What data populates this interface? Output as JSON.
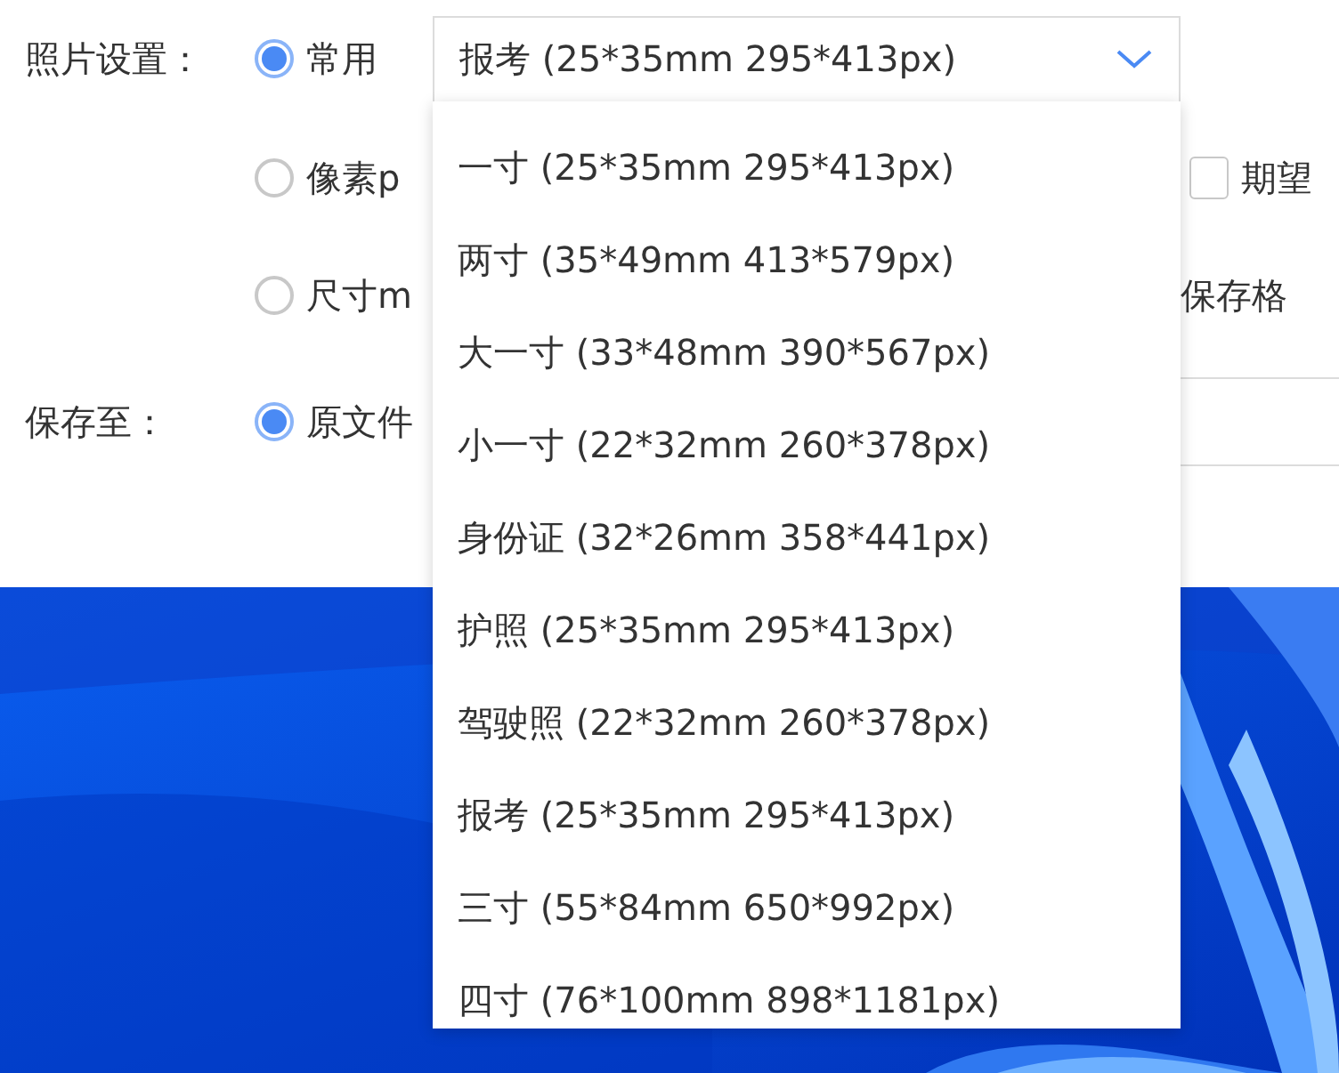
{
  "photo_setting": {
    "label": "照片设置：",
    "preset_radio": {
      "label": "常用",
      "selected": true
    },
    "preset_select": {
      "value": "报考 (25*35mm 295*413px)"
    },
    "pixel_radio": {
      "label": "像素p",
      "selected": false
    },
    "expect_checkbox": {
      "label": "期望",
      "checked": false
    },
    "size_radio": {
      "label": "尺寸m",
      "selected": false
    },
    "format_label": "保存格"
  },
  "save_to": {
    "label": "保存至：",
    "radio": {
      "label": "原文件",
      "selected": true
    }
  },
  "dropdown": {
    "items": [
      {
        "label": "一寸 (25*35mm 295*413px)",
        "selected": false
      },
      {
        "label": "两寸 (35*49mm 413*579px)",
        "selected": false
      },
      {
        "label": "大一寸 (33*48mm 390*567px)",
        "selected": false
      },
      {
        "label": "小一寸 (22*32mm 260*378px)",
        "selected": false
      },
      {
        "label": "身份证 (32*26mm 358*441px)",
        "selected": false
      },
      {
        "label": "护照 (25*35mm 295*413px)",
        "selected": false
      },
      {
        "label": "驾驶照 (22*32mm 260*378px)",
        "selected": false
      },
      {
        "label": "报考 (25*35mm 295*413px)",
        "selected": false
      },
      {
        "label": "三寸 (55*84mm 650*992px)",
        "selected": false
      },
      {
        "label": "四寸 (76*100mm 898*1181px)",
        "selected": false
      }
    ]
  }
}
